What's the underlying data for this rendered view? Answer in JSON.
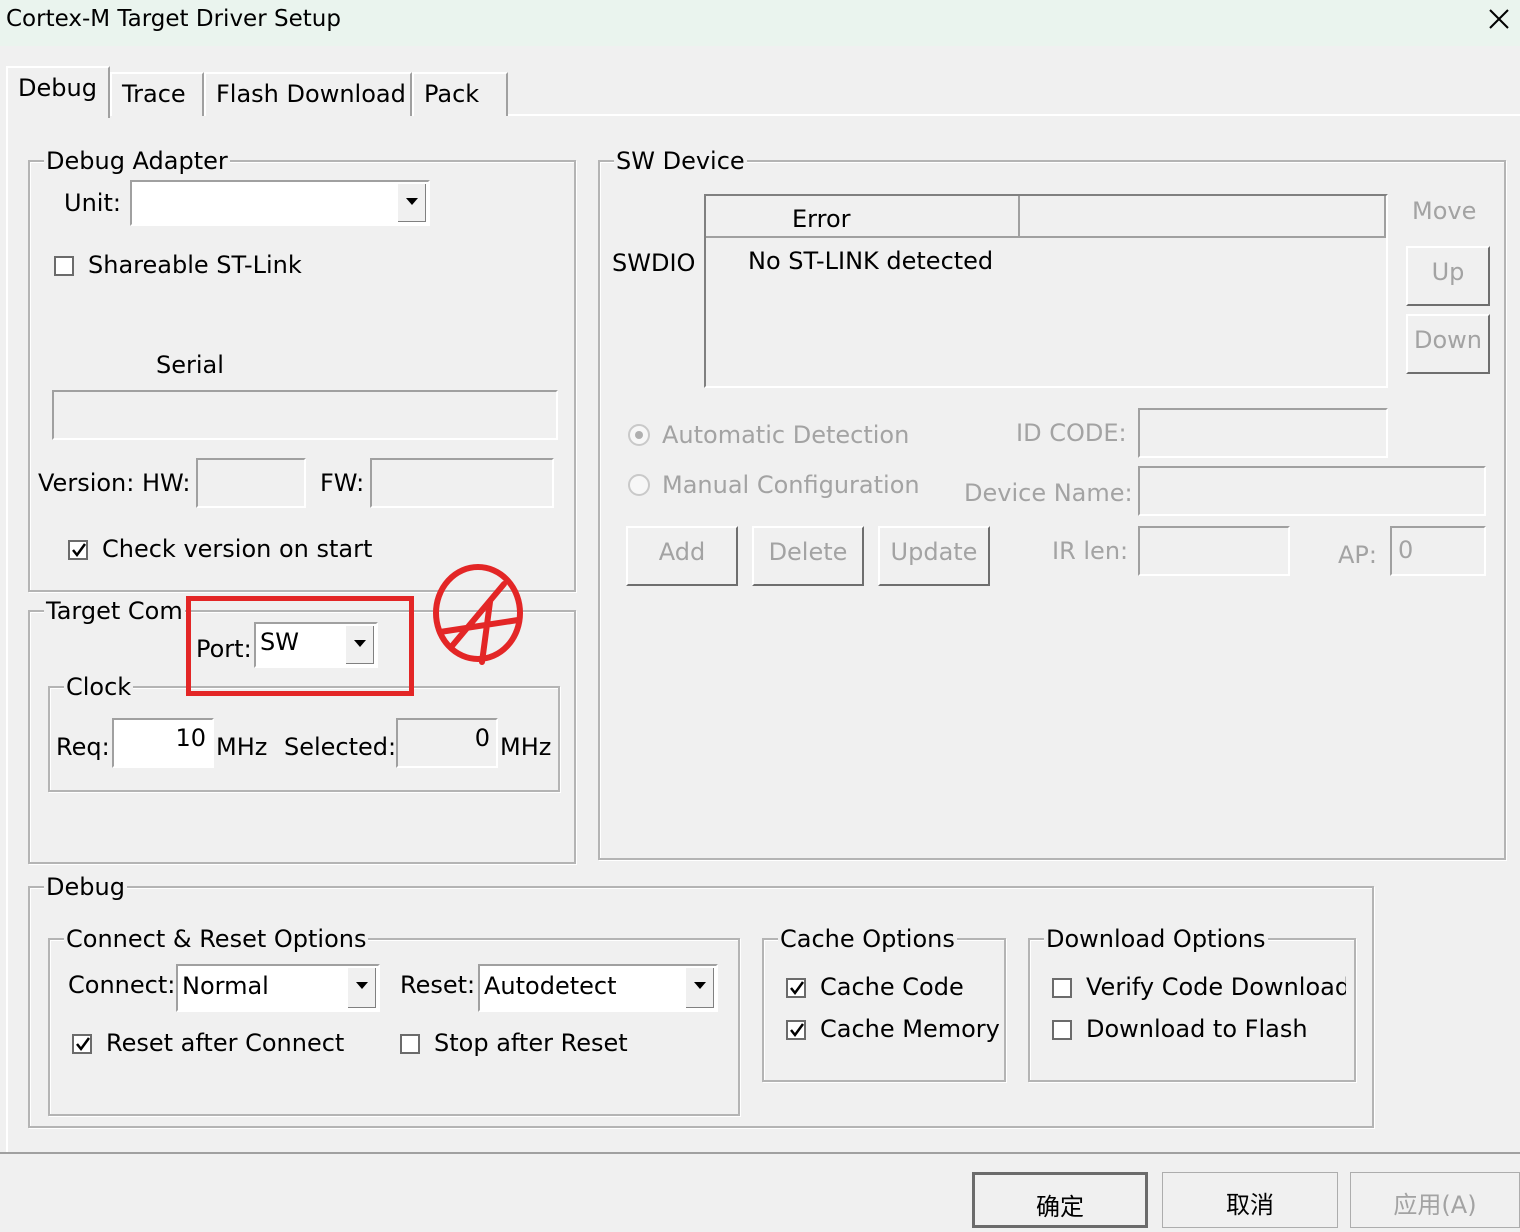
{
  "window": {
    "title": "Cortex-M Target Driver Setup"
  },
  "tabs": [
    {
      "label": "Debug"
    },
    {
      "label": "Trace"
    },
    {
      "label": "Flash Download"
    },
    {
      "label": "Pack"
    }
  ],
  "debug_adapter": {
    "legend": "Debug Adapter",
    "unit_label": "Unit:",
    "unit_value": "",
    "shareable_label": "Shareable ST-Link",
    "serial_label": "Serial",
    "serial_value": "",
    "version_label": "Version: HW:",
    "hw_value": "",
    "fw_label": "FW:",
    "fw_value": "",
    "check_version_label": "Check version on start"
  },
  "target_com": {
    "legend": "Target Com",
    "port_label": "Port:",
    "port_value": "SW",
    "clock_legend": "Clock",
    "req_label": "Req:",
    "req_value": "10",
    "mhz1": "MHz",
    "selected_label": "Selected:",
    "selected_value": "0",
    "mhz2": "MHz"
  },
  "sw_device": {
    "legend": "SW Device",
    "swdio_label": "SWDIO",
    "col1": "Error",
    "col2": "",
    "row_text": "No ST-LINK detected",
    "move_label": "Move",
    "up_label": "Up",
    "down_label": "Down",
    "auto_label": "Automatic Detection",
    "manual_label": "Manual Configuration",
    "id_code_label": "ID CODE:",
    "device_name_label": "Device Name:",
    "ir_len_label": "IR len:",
    "ap_label": "AP:",
    "ap_value": "0",
    "add_label": "Add",
    "delete_label": "Delete",
    "update_label": "Update"
  },
  "debug": {
    "legend": "Debug",
    "connect_reset": {
      "legend": "Connect & Reset Options",
      "connect_label": "Connect:",
      "connect_value": "Normal",
      "reset_label": "Reset:",
      "reset_value": "Autodetect",
      "reset_after_label": "Reset after Connect",
      "stop_after_label": "Stop after Reset"
    },
    "cache": {
      "legend": "Cache Options",
      "code_label": "Cache Code",
      "memory_label": "Cache Memory"
    },
    "download": {
      "legend": "Download Options",
      "verify_label": "Verify Code Download",
      "flash_label": "Download to Flash"
    }
  },
  "footer": {
    "ok": "确定",
    "cancel": "取消",
    "apply": "应用(A)"
  },
  "colors": {
    "annotation": "#e32626",
    "disabled_text": "#a3a3a3"
  }
}
